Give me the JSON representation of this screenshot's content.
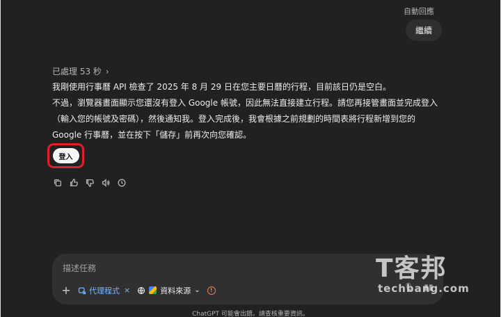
{
  "header": {
    "auto_reply_label": "自動回應"
  },
  "user_message": {
    "text": "繼續"
  },
  "assistant": {
    "processed_label": "已處理 53 秒",
    "paragraph1": "我剛使用行事曆 API 檢查了 2025 年 8 月 29 日在您主要日曆的行程，目前該日仍是空白。",
    "paragraph2": "不過，瀏覽器畫面顯示您還沒有登入 Google 帳號，因此無法直接建立行程。請您再接管畫面並完成登入（輸入您的帳號及密碼），然後通知我。登入完成後，我會根據之前規劃的時間表將行程新增到您的 Google 行事曆，並在按下「儲存」前再次向您確認。",
    "login_button_label": "登入"
  },
  "action_icons": [
    "copy-icon",
    "thumbs-up-icon",
    "thumbs-down-icon",
    "speaker-icon",
    "history-icon"
  ],
  "composer": {
    "placeholder": "描述任務",
    "agent_chip_label": "代理程式",
    "sources_label": "資料來源"
  },
  "footer": {
    "disclaimer": "ChatGPT 可能會出錯。請查核重要資訊。"
  },
  "watermark": {
    "title": "T客邦",
    "subtitle": "techbang.com"
  },
  "colors": {
    "background": "#212121",
    "highlight_border": "#e11d2e",
    "accent": "#7ab7ff"
  }
}
